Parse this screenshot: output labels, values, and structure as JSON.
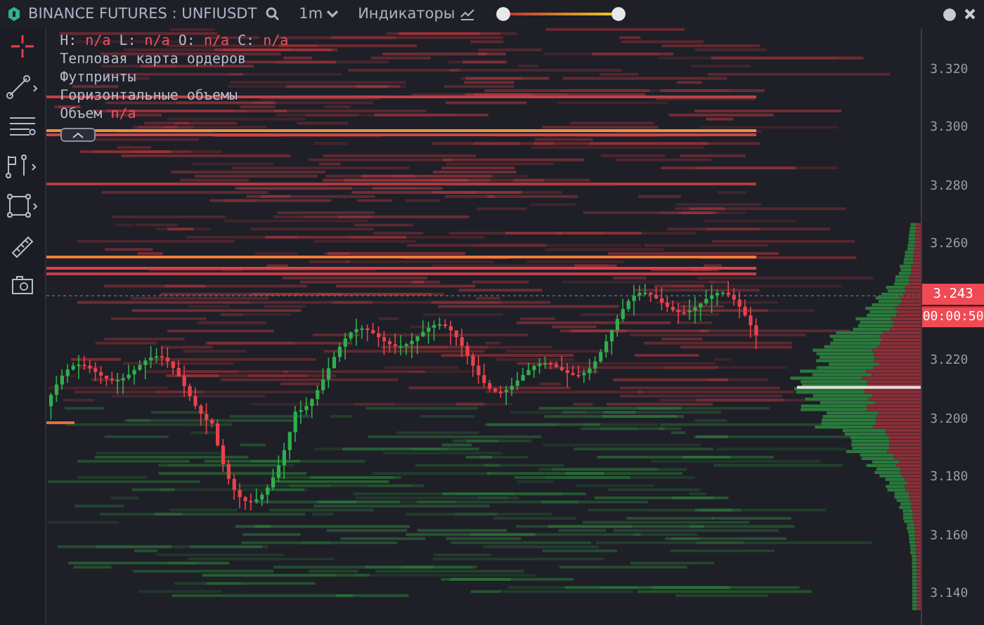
{
  "header": {
    "title": "BINANCE FUTURES : UNFIUSDT",
    "timeframe": "1m",
    "indicators_label": "Индикаторы",
    "range_slider": {
      "level": 1
    }
  },
  "legend": [
    {
      "label": "H:",
      "value": "n/a"
    },
    {
      "label": "L:",
      "value": "n/a"
    },
    {
      "label": "O:",
      "value": "n/a"
    },
    {
      "label": "C:",
      "value": "n/a"
    }
  ],
  "indicators": [
    {
      "label": "Тепловая карта ордеров"
    },
    {
      "label": "Футпринты"
    },
    {
      "label": "Горизонтальные объемы"
    },
    {
      "label": "Объем",
      "value": "n/a"
    }
  ],
  "price_axis": {
    "ticks": [
      "3.320",
      "3.300",
      "3.280",
      "3.260",
      "3.220",
      "3.200",
      "3.180",
      "3.160",
      "3.140"
    ],
    "current_price": "3.243",
    "countdown": "00:00:50"
  }
}
